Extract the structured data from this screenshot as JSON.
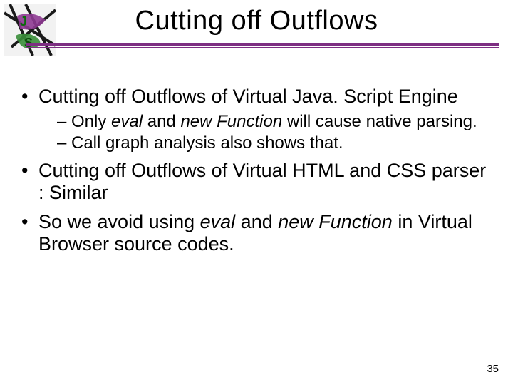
{
  "title": "Cutting off Outflows",
  "bullets": {
    "b1": "Cutting off Outflows of Virtual Java. Script Engine",
    "b1_sub": {
      "s1_pre": "Only ",
      "s1_kw1": "eval",
      "s1_mid": " and ",
      "s1_kw2": "new Function",
      "s1_post": " will cause native parsing.",
      "s2": "Call graph analysis also shows that."
    },
    "b2": "Cutting off Outflows of Virtual HTML and CSS parser : Similar",
    "b3_pre": "So we avoid using ",
    "b3_kw1": "eval",
    "b3_mid": " and ",
    "b3_kw2": "new Function",
    "b3_post": " in Virtual Browser source codes."
  },
  "page_number": "35",
  "colors": {
    "accent": "#7d2e82"
  }
}
